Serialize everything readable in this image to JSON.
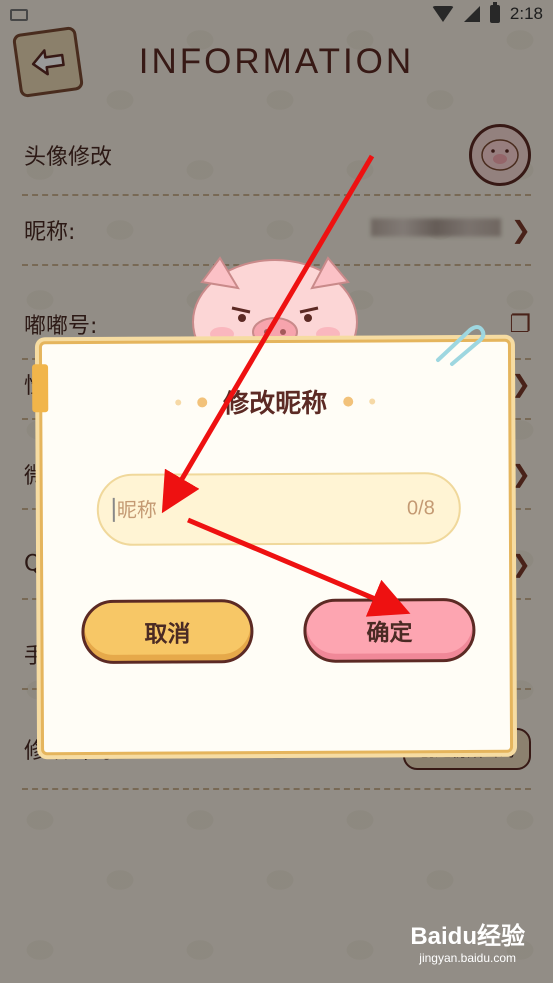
{
  "status_bar": {
    "time": "2:18"
  },
  "header": {
    "title": "INFORMATION"
  },
  "rows": {
    "avatar": {
      "label": "头像修改"
    },
    "nickname": {
      "label": "昵称:"
    },
    "dudu_id": {
      "label": "嘟嘟号:"
    },
    "gender": {
      "label": "性"
    },
    "wechat": {
      "label": "微"
    },
    "qq": {
      "label": "Q"
    },
    "phone": {
      "label": "手"
    },
    "password": {
      "label": "修改密码",
      "button": "创建初始密码"
    }
  },
  "dialog": {
    "title": "修改昵称",
    "input": {
      "placeholder": "昵称",
      "value": "",
      "counter": "0/8"
    },
    "cancel_label": "取消",
    "confirm_label": "确定"
  },
  "watermark": {
    "brand": "Baidu经验",
    "sub": "jingyan.baidu.com"
  },
  "colors": {
    "title": "#5c2a24",
    "cancel": "#f7c766",
    "confirm": "#fda5b1",
    "arrow": "#ee1111"
  }
}
